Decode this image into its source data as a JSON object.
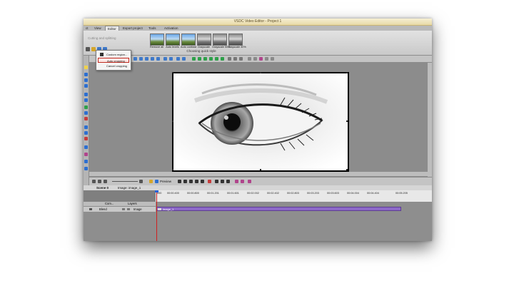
{
  "window": {
    "title": "VSDC Video Editor - Project 1"
  },
  "menu": {
    "items": [
      "ct",
      "View",
      "Editor",
      "Export project",
      "Tools",
      "Activation"
    ],
    "active": "Editor"
  },
  "ribbon": {
    "disabled_label": "Cutting and splitting",
    "quick_styles": [
      "Remove all",
      "Auto levels",
      "Auto contrast",
      "Grayscale",
      "Grayscale 50%",
      "Grayscale 30%"
    ],
    "group_caption": "Choosing quick style"
  },
  "crop_menu": {
    "items": [
      "Custom region...",
      "Auto cropping",
      "Cancel cropping"
    ],
    "selected": "Auto cropping"
  },
  "transport": {
    "preview_label": "Preview"
  },
  "timeline": {
    "scene_tab": "Scene 0",
    "breadcrumb": "Image: image_1",
    "ruler_ticks": [
      "000",
      "00:00.400",
      "00:00.800",
      "00:01.201",
      "00:01.601",
      "00:02.002",
      "00:02.402",
      "00:02.803",
      "00:03.203",
      "00:03.603",
      "00:04.004",
      "00:04.404",
      "00:05.205"
    ],
    "layers_header": {
      "com": "Com...",
      "layers": "Layers"
    },
    "track": {
      "blend": "Blend",
      "type": "Image",
      "clip_name": "image_1"
    }
  },
  "colors": {
    "clip": "#8e69c9",
    "cursor": "#d02020",
    "titlebar": "#efe4bd",
    "menu_highlight": "#c0281e"
  }
}
